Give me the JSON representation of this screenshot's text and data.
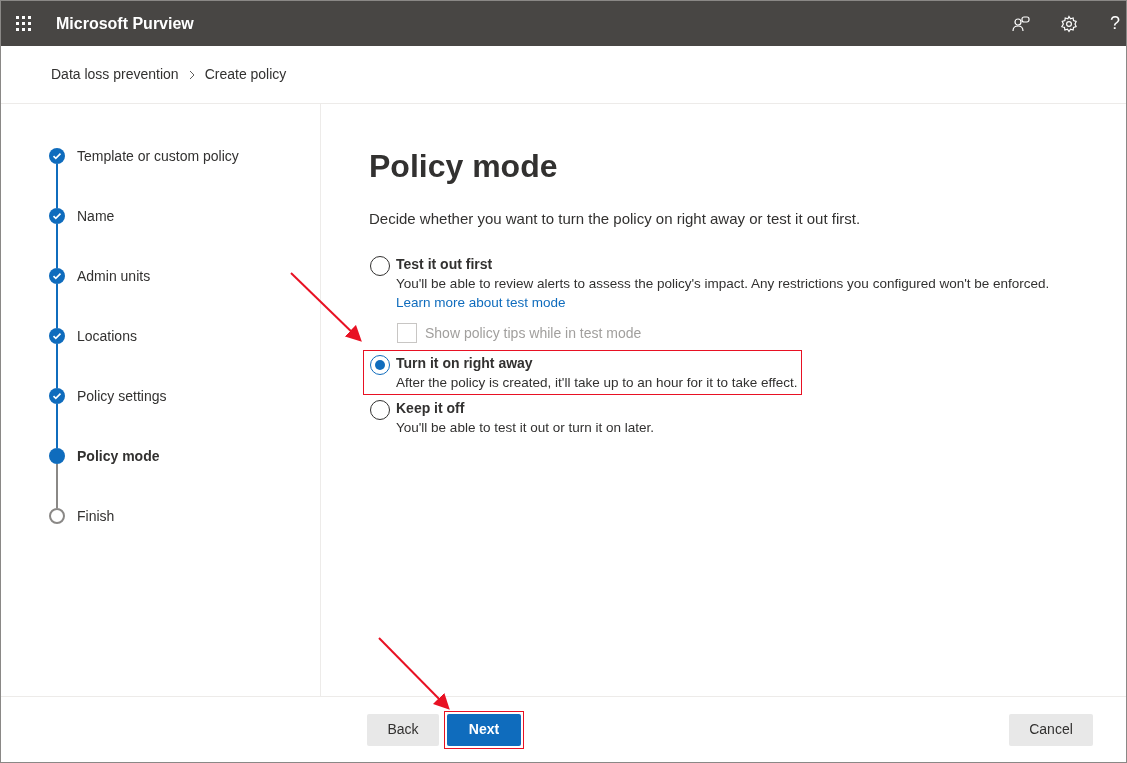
{
  "header": {
    "app_name": "Microsoft Purview",
    "help": "?"
  },
  "breadcrumb": [
    "Data loss prevention",
    "Create policy"
  ],
  "steps": [
    {
      "label": "Template or custom policy",
      "kind": "done"
    },
    {
      "label": "Name",
      "kind": "done"
    },
    {
      "label": "Admin units",
      "kind": "done"
    },
    {
      "label": "Locations",
      "kind": "done"
    },
    {
      "label": "Policy settings",
      "kind": "done"
    },
    {
      "label": "Policy mode",
      "kind": "current"
    },
    {
      "label": "Finish",
      "kind": "pending"
    }
  ],
  "page": {
    "title": "Policy mode",
    "description": "Decide whether you want to turn the policy on right away or test it out first."
  },
  "options": [
    {
      "label": "Test it out first",
      "description": "You'll be able to review alerts to assess the policy's impact. Any restrictions you configured won't be enforced.",
      "link": "Learn more about test mode",
      "selected": false,
      "highlighted": false,
      "sub_checkbox": {
        "label": "Show policy tips while in test mode",
        "checked": false,
        "disabled": true
      }
    },
    {
      "label": "Turn it on right away",
      "description": "After the policy is created, it'll take up to an hour for it to take effect.",
      "selected": true,
      "highlighted": true
    },
    {
      "label": "Keep it off",
      "description": "You'll be able to test it out or turn it on later.",
      "selected": false,
      "highlighted": false
    }
  ],
  "footer": {
    "buttons": [
      {
        "label": "Back",
        "kind": "secondary",
        "highlighted": false
      },
      {
        "label": "Next",
        "kind": "primary",
        "highlighted": true
      }
    ],
    "cancel": "Cancel"
  }
}
